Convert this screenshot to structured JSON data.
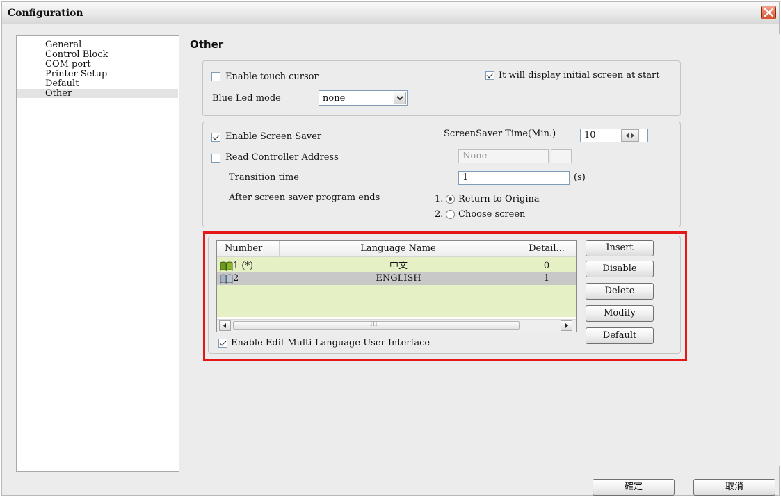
{
  "window": {
    "title": "Configuration"
  },
  "sidebar": {
    "items": [
      {
        "label": "General"
      },
      {
        "label": "Control Block"
      },
      {
        "label": "COM port"
      },
      {
        "label": "Printer Setup"
      },
      {
        "label": "Default"
      },
      {
        "label": "Other"
      }
    ],
    "selected": "Other"
  },
  "section": {
    "title": "Other"
  },
  "group1": {
    "enable_touch_cursor": {
      "label": "Enable touch cursor",
      "checked": false
    },
    "initial_screen": {
      "label": "It will display initial screen at start",
      "checked": true
    },
    "blue_led": {
      "label": "Blue Led mode",
      "value": "none"
    }
  },
  "group2": {
    "enable_screen_saver": {
      "label": "Enable Screen Saver",
      "checked": true
    },
    "screensaver_time": {
      "label": "ScreenSaver Time(Min.)",
      "value": "10"
    },
    "read_controller": {
      "label": "Read Controller Address",
      "checked": false,
      "value": "None"
    },
    "transition": {
      "label": "Transition time",
      "value": "1",
      "unit": "(s)"
    },
    "after_end": {
      "label": "After screen saver program ends",
      "option1_num": "1.",
      "option1": "Return to Origina",
      "option2_num": "2.",
      "option2": "Choose screen",
      "selected": 1
    }
  },
  "languages": {
    "columns": {
      "number": "Number",
      "name": "Language Name",
      "detail": "Detail..."
    },
    "rows": [
      {
        "number": "1 (*)",
        "name": "中文",
        "detail": "0"
      },
      {
        "number": "2",
        "name": "ENGLISH",
        "detail": "1"
      }
    ],
    "selected_row": 1,
    "scroll_thumb_label": "III",
    "enable_edit": {
      "label": "Enable Edit Multi-Language User Interface",
      "checked": true
    },
    "buttons": {
      "insert": "Insert",
      "disable": "Disable",
      "delete": "Delete",
      "modify": "Modify",
      "default": "Default"
    }
  },
  "footer": {
    "ok": "確定",
    "cancel": "取消"
  },
  "colors": {
    "highlight": "#e51717",
    "list_bg": "#e6f0c5",
    "selected_row": "#c8c8c8"
  }
}
